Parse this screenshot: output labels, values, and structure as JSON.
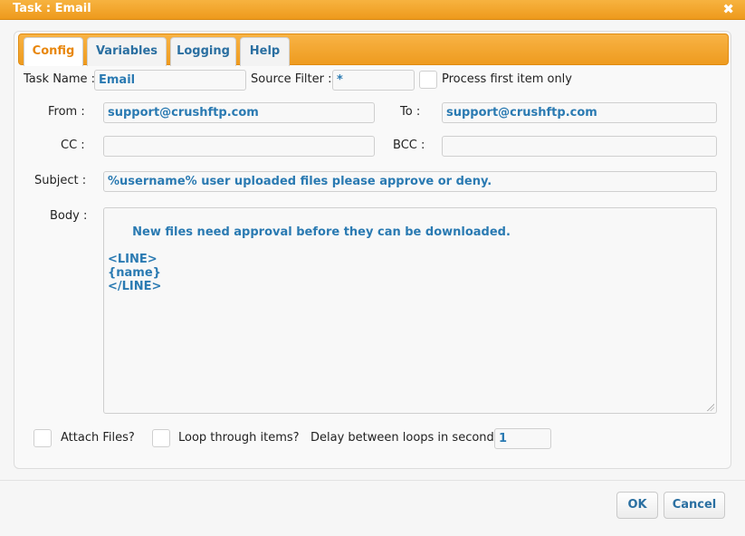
{
  "window": {
    "title": "Task : Email",
    "close_glyph": "✖"
  },
  "tabs": [
    {
      "label": "Config",
      "active": true
    },
    {
      "label": "Variables",
      "active": false
    },
    {
      "label": "Logging",
      "active": false
    },
    {
      "label": "Help",
      "active": false
    }
  ],
  "form": {
    "task_name_label": "Task Name :",
    "task_name_value": "Email",
    "source_filter_label": "Source Filter :",
    "source_filter_value": "*",
    "process_first_label": "Process first item only",
    "process_first_checked": false,
    "from_label": "From :",
    "from_value": "support@crushftp.com",
    "to_label": "To :",
    "to_value": "support@crushftp.com",
    "cc_label": "CC :",
    "cc_value": "",
    "bcc_label": "BCC :",
    "bcc_value": "",
    "subject_label": "Subject :",
    "subject_value": "%username% user uploaded files please approve or deny.",
    "body_label": "Body :",
    "body_value": "New files need approval before they can be downloaded.\n\n<LINE>\n{name}\n</LINE>",
    "attach_files_label": "Attach Files?",
    "attach_files_checked": false,
    "loop_items_label": "Loop through items?",
    "loop_items_checked": false,
    "delay_label": "Delay between loops in seconds :",
    "delay_value": "1"
  },
  "buttons": {
    "ok": "OK",
    "cancel": "Cancel"
  },
  "colors": {
    "accent_orange": "#ee9b1f",
    "link_blue": "#2a6fa1",
    "value_blue": "#2a7ab2"
  }
}
